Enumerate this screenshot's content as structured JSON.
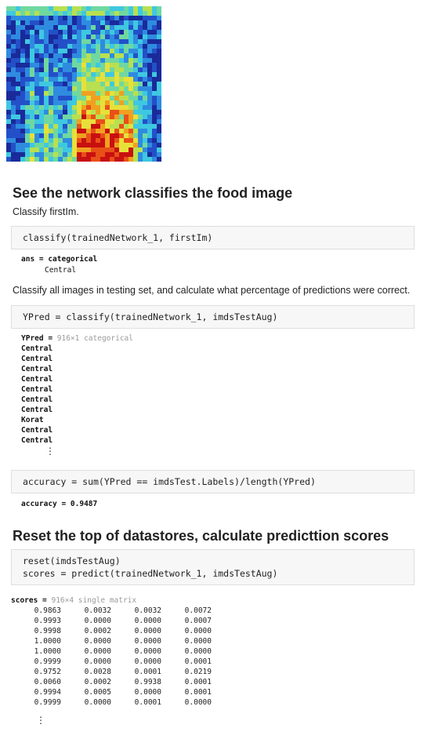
{
  "heading1": "See the network classifies the food image",
  "text_classify_first": "Classify firstIm.",
  "code1": "classify(trainedNetwork_1, firstIm)",
  "output1": {
    "ans_label": "ans = categorical",
    "ans_value": "Central"
  },
  "text_classify_all": "Classify all images in testing set, and calculate what percentage of predictions were correct.",
  "code2": "YPred = classify(trainedNetwork_1, imdsTestAug)",
  "output2": {
    "var": "YPred = ",
    "size": "916×1 categorical",
    "values": [
      "Central",
      "Central",
      "Central",
      "Central",
      "Central",
      "Central",
      "Central",
      "Korat",
      "Central",
      "Central"
    ]
  },
  "code3": "accuracy = sum(YPred == imdsTest.Labels)/length(YPred)",
  "output3": "accuracy = 0.9487",
  "heading2": "Reset the top of datastores, calculate predicttion scores",
  "code4": [
    "reset(imdsTestAug)",
    "scores = predict(trainedNetwork_1, imdsTestAug)"
  ],
  "output4": {
    "var": "scores = ",
    "size": "916×4 single matrix",
    "rows": [
      [
        "0.9863",
        "0.0032",
        "0.0032",
        "0.0072"
      ],
      [
        "0.9993",
        "0.0000",
        "0.0000",
        "0.0007"
      ],
      [
        "0.9998",
        "0.0002",
        "0.0000",
        "0.0000"
      ],
      [
        "1.0000",
        "0.0000",
        "0.0000",
        "0.0000"
      ],
      [
        "1.0000",
        "0.0000",
        "0.0000",
        "0.0000"
      ],
      [
        "0.9999",
        "0.0000",
        "0.0000",
        "0.0001"
      ],
      [
        "0.9752",
        "0.0028",
        "0.0001",
        "0.0219"
      ],
      [
        "0.0060",
        "0.0002",
        "0.9938",
        "0.0001"
      ],
      [
        "0.9994",
        "0.0005",
        "0.0000",
        "0.0001"
      ],
      [
        "0.9999",
        "0.0000",
        "0.0001",
        "0.0000"
      ]
    ]
  },
  "ellipsis_glyph": "⋮"
}
